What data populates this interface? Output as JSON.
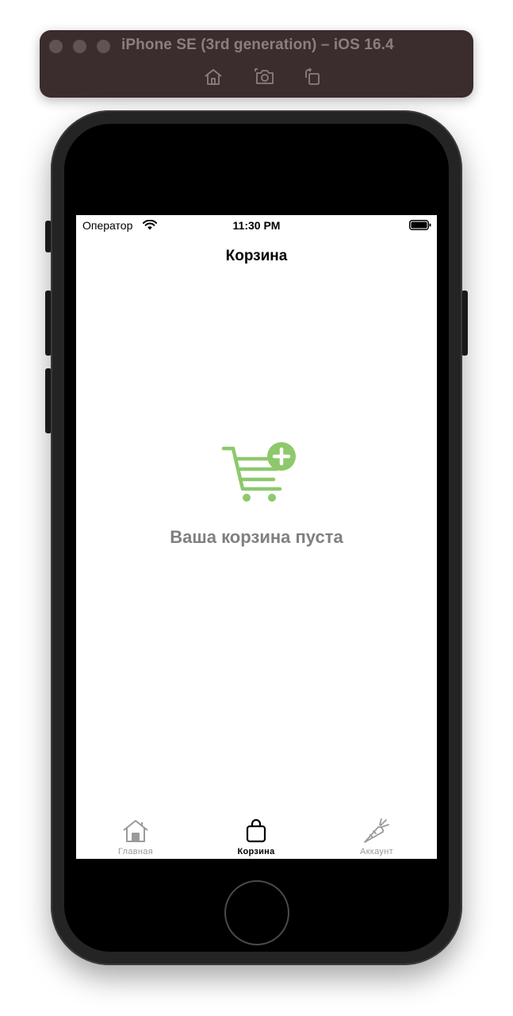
{
  "simulator": {
    "title": "iPhone SE (3rd generation) – iOS 16.4",
    "toolbar_icons": [
      "home-icon",
      "screenshot-icon",
      "rotate-icon"
    ]
  },
  "status_bar": {
    "carrier": "Оператор",
    "time": "11:30 PM"
  },
  "nav": {
    "title": "Корзина"
  },
  "empty_state": {
    "icon": "cart-plus-icon",
    "message": "Ваша корзина пуста",
    "accent_color": "#8dc96b"
  },
  "tab_bar": {
    "tabs": [
      {
        "label": "Главная",
        "icon": "house-icon",
        "active": false
      },
      {
        "label": "Корзина",
        "icon": "bag-icon",
        "active": true
      },
      {
        "label": "Аккаунт",
        "icon": "carrot-icon",
        "active": false
      }
    ]
  }
}
